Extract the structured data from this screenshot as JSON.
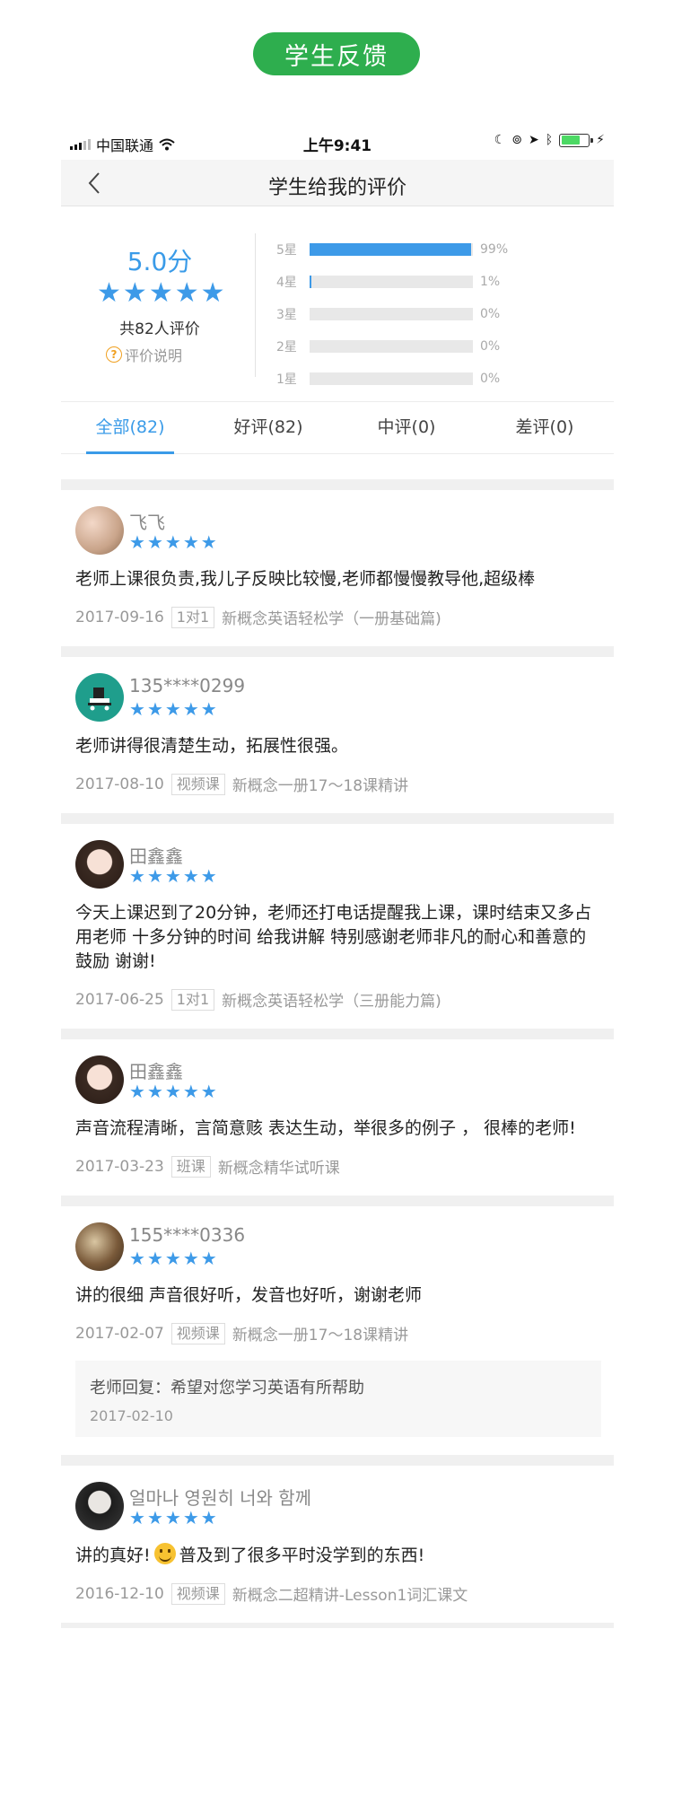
{
  "poster_title": "学生反馈",
  "status_bar": {
    "carrier": "中国联通",
    "time": "上午9:41"
  },
  "nav": {
    "title": "学生给我的评价"
  },
  "summary": {
    "score": "5.0分",
    "rating": 5,
    "count_text": "共82人评价",
    "help_label": "评价说明",
    "distribution": [
      {
        "label": "5星",
        "percent": 99,
        "pct_text": "99%"
      },
      {
        "label": "4星",
        "percent": 1,
        "pct_text": "1%"
      },
      {
        "label": "3星",
        "percent": 0,
        "pct_text": "0%"
      },
      {
        "label": "2星",
        "percent": 0,
        "pct_text": "0%"
      },
      {
        "label": "1星",
        "percent": 0,
        "pct_text": "0%"
      }
    ]
  },
  "tabs": [
    {
      "label": "全部(82)",
      "active": true
    },
    {
      "label": "好评(82)",
      "active": false
    },
    {
      "label": "中评(0)",
      "active": false
    },
    {
      "label": "差评(0)",
      "active": false
    }
  ],
  "colors": {
    "accent": "#3a9be8",
    "badge_green": "#2eae4e"
  },
  "reviews": [
    {
      "name": "飞飞",
      "rating": 5,
      "text": "老师上课很负责,我儿子反映比较慢,老师都慢慢教导他,超级棒",
      "date": "2017-09-16",
      "tag": "1对1",
      "course": "新概念英语轻松学（一册基础篇)"
    },
    {
      "name": "135****0299",
      "rating": 5,
      "text": "老师讲得很清楚生动，拓展性很强。",
      "date": "2017-08-10",
      "tag": "视频课",
      "course": "新概念一册17～18课精讲"
    },
    {
      "name": "田鑫鑫",
      "rating": 5,
      "text": "今天上课迟到了20分钟，老师还打电话提醒我上课，课时结束又多占用老师 十多分钟的时间 给我讲解 特别感谢老师非凡的耐心和善意的鼓励 谢谢!",
      "date": "2017-06-25",
      "tag": "1对1",
      "course": "新概念英语轻松学（三册能力篇)"
    },
    {
      "name": "田鑫鑫",
      "rating": 5,
      "text": "声音流程清晰，言简意赅 表达生动，举很多的例子 ， 很棒的老师!",
      "date": "2017-03-23",
      "tag": "班课",
      "course": "新概念精华试听课"
    },
    {
      "name": "155****0336",
      "rating": 5,
      "text": "讲的很细 声音很好听，发音也好听，谢谢老师",
      "date": "2017-02-07",
      "tag": "视频课",
      "course": "新概念一册17～18课精讲",
      "reply": {
        "text": "老师回复：希望对您学习英语有所帮助",
        "date": "2017-02-10"
      }
    },
    {
      "name": "얼마나 영원히 너와 함께",
      "rating": 5,
      "text_before": "讲的真好!",
      "text_after": "普及到了很多平时没学到的东西!",
      "date": "2016-12-10",
      "tag": "视频课",
      "course": "新概念二超精讲-Lesson1词汇课文"
    }
  ]
}
